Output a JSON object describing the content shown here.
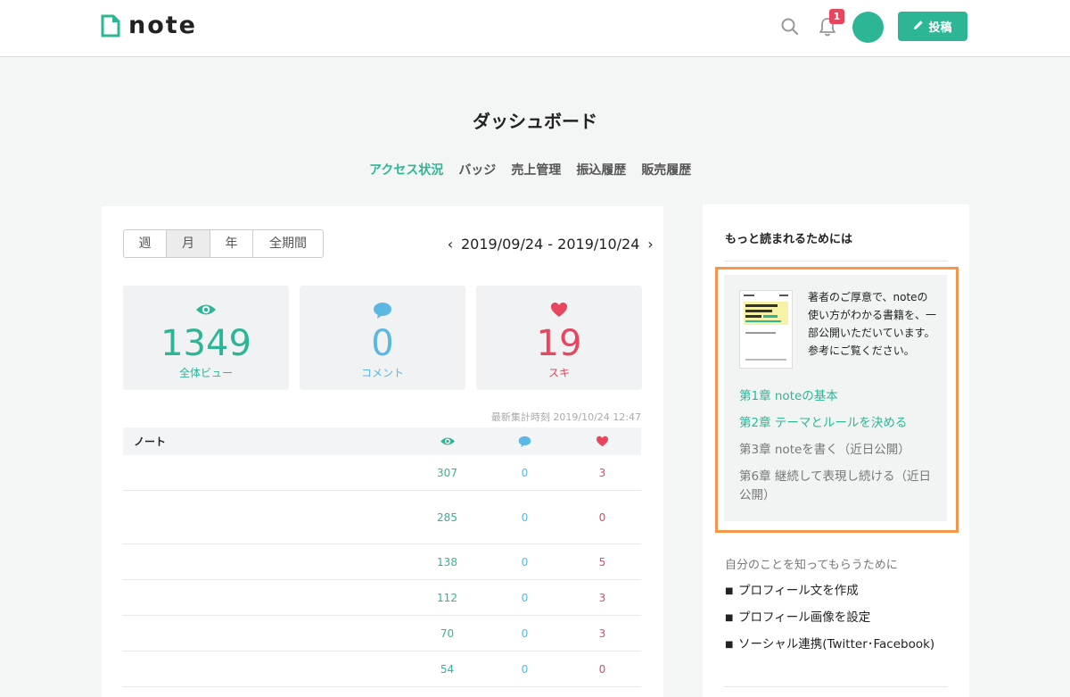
{
  "header": {
    "logo_text": "note",
    "notification_count": "1",
    "post_label": "投稿",
    "icons": [
      "note-logo-icon",
      "search-icon",
      "bell-icon",
      "pencil-icon"
    ],
    "colors": {
      "brand": "#2cb696",
      "badge": "#e8455e"
    }
  },
  "page": {
    "title": "ダッシュボード"
  },
  "tabs": [
    {
      "label": "アクセス状況",
      "active": true
    },
    {
      "label": "バッジ"
    },
    {
      "label": "売上管理"
    },
    {
      "label": "振込履歴"
    },
    {
      "label": "販売履歴"
    }
  ],
  "period": {
    "options": [
      "週",
      "月",
      "年",
      "全期間"
    ],
    "selected": "月"
  },
  "date_range": {
    "text": "2019/09/24 - 2019/10/24"
  },
  "stats": [
    {
      "value": "1349",
      "label": "全体ビュー",
      "icon": "eye-icon",
      "color": "#2cb696"
    },
    {
      "value": "0",
      "label": "コメント",
      "icon": "comment-icon",
      "color": "#5ab8e3"
    },
    {
      "value": "19",
      "label": "スキ",
      "icon": "heart-icon",
      "color": "#e8455e"
    }
  ],
  "updated_text": "最新集計時刻 2019/10/24 12:47",
  "table": {
    "header_note": "ノート",
    "rows": [
      {
        "views": "307",
        "comments": "0",
        "likes": "3"
      },
      {
        "views": "285",
        "comments": "0",
        "likes": "0"
      },
      {
        "views": "138",
        "comments": "0",
        "likes": "5"
      },
      {
        "views": "112",
        "comments": "0",
        "likes": "3"
      },
      {
        "views": "70",
        "comments": "0",
        "likes": "3"
      },
      {
        "views": "54",
        "comments": "0",
        "likes": "0"
      }
    ]
  },
  "sidebar": {
    "title": "もっと読まれるためには",
    "book_description": "著者のご厚意で、noteの使い方がわかる書籍を、一部公開いただいています。参考にご覧ください。",
    "chapters": [
      {
        "label": "第1章 noteの基本",
        "linked": true
      },
      {
        "label": "第2章 テーマとルールを決める",
        "linked": true
      },
      {
        "label": "第3章 noteを書く（近日公開）",
        "linked": false
      },
      {
        "label": "第6章 継続して表現し続ける（近日公開）",
        "linked": false
      }
    ],
    "profile_heading": "自分のことを知ってもらうために",
    "profile_tasks": [
      "プロフィール文を作成",
      "プロフィール画像を設定",
      "ソーシャル連携(Twitter･Facebook)"
    ],
    "highlight_color": "#f5964b"
  }
}
